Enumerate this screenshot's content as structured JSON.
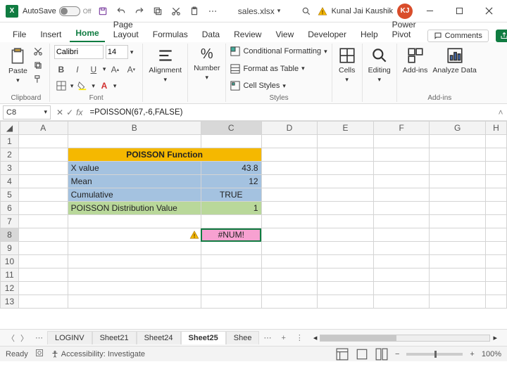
{
  "titlebar": {
    "autosave_label": "AutoSave",
    "autosave_state": "Off",
    "filename": "sales.xlsx",
    "saved_indicator": "•",
    "search_placeholder": "Search",
    "user_name": "Kunal Jai Kaushik",
    "user_initials": "KJ"
  },
  "tabs": {
    "items": [
      "File",
      "Insert",
      "Home",
      "Page Layout",
      "Formulas",
      "Data",
      "Review",
      "View",
      "Developer",
      "Help",
      "Power Pivot"
    ],
    "active": "Home",
    "comments_label": "Comments"
  },
  "ribbon": {
    "clipboard": {
      "label": "Clipboard",
      "paste": "Paste"
    },
    "font": {
      "label": "Font",
      "name": "Calibri",
      "size": "14"
    },
    "alignment": {
      "label": "Alignment",
      "btn": "Alignment"
    },
    "number": {
      "label": "Number",
      "btn": "Number"
    },
    "styles": {
      "label": "Styles",
      "cond": "Conditional Formatting",
      "table": "Format as Table",
      "cell": "Cell Styles"
    },
    "cells": {
      "label": "",
      "btn": "Cells"
    },
    "editing": {
      "label": "",
      "btn": "Editing"
    },
    "addins": {
      "label": "Add-ins",
      "btn": "Add-ins",
      "analyze": "Analyze Data"
    }
  },
  "formula_bar": {
    "cell_ref": "C8",
    "formula": "=POISSON(67,-6,FALSE)"
  },
  "grid": {
    "cols": [
      "A",
      "B",
      "C",
      "D",
      "E",
      "F",
      "G",
      "H"
    ],
    "rows": [
      1,
      2,
      3,
      4,
      5,
      6,
      7,
      8,
      9,
      10,
      11,
      12,
      13
    ],
    "header_title": "POISSON Function",
    "r3": {
      "b": "X value",
      "c": "43.8"
    },
    "r4": {
      "b": "Mean",
      "c": "12"
    },
    "r5": {
      "b": "Cumulative",
      "c": "TRUE"
    },
    "r6": {
      "b": "POISSON Distribution Value",
      "c": "1"
    },
    "r8_error": "#NUM!"
  },
  "sheet_tabs": {
    "items": [
      "LOGINV",
      "Sheet21",
      "Sheet24",
      "Sheet25",
      "Shee"
    ],
    "active": "Sheet25"
  },
  "status": {
    "ready": "Ready",
    "accessibility": "Accessibility: Investigate",
    "zoom": "100%"
  }
}
